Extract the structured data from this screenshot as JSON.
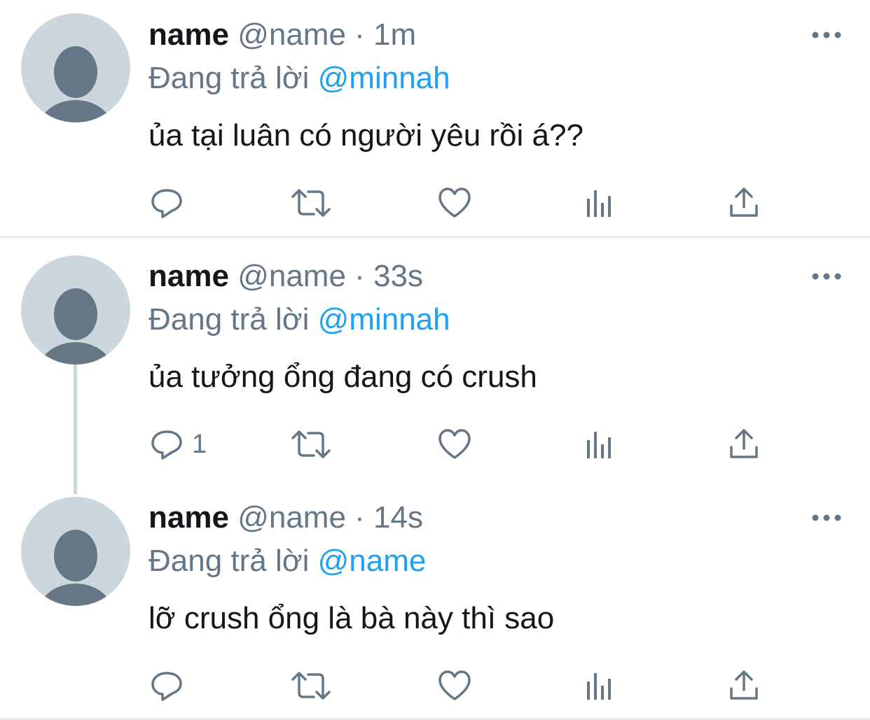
{
  "tweets": [
    {
      "name": "name",
      "handle": "@name",
      "separator": "·",
      "time": "1m",
      "replying_prefix": "Đang trả lời",
      "replying_to": "@minnah",
      "text": "ủa tại luân có người yêu rồi á??",
      "reply_count": ""
    },
    {
      "name": "name",
      "handle": "@name",
      "separator": "·",
      "time": "33s",
      "replying_prefix": "Đang trả lời",
      "replying_to": "@minnah",
      "text": "ủa tưởng ổng đang có crush",
      "reply_count": "1"
    },
    {
      "name": "name",
      "handle": "@name",
      "separator": "·",
      "time": "14s",
      "replying_prefix": "Đang trả lời",
      "replying_to": "@name",
      "text": "lỡ crush ổng là bà này thì sao",
      "reply_count": ""
    }
  ],
  "colors": {
    "text_primary": "#14171a",
    "text_secondary": "#657786",
    "mention": "#1da1f2",
    "avatar_bg": "#ccd6dd",
    "avatar_figure": "#657786",
    "divider": "#e6ecf0"
  },
  "icons": [
    "more-icon",
    "reply-icon",
    "retweet-icon",
    "like-icon",
    "stats-icon",
    "share-icon"
  ]
}
